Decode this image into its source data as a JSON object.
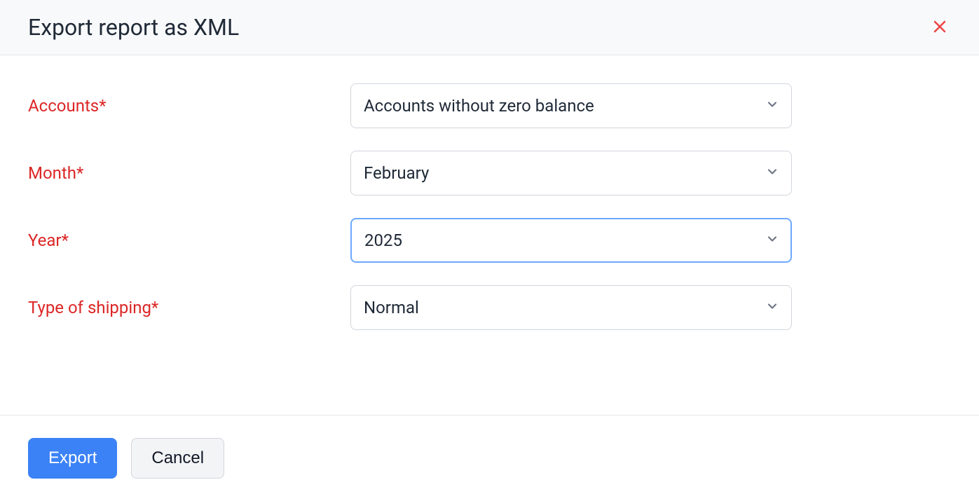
{
  "header": {
    "title": "Export report as XML"
  },
  "form": {
    "accounts": {
      "label": "Accounts*",
      "value": "Accounts without zero balance"
    },
    "month": {
      "label": "Month*",
      "value": "February"
    },
    "year": {
      "label": "Year*",
      "value": "2025"
    },
    "shipping": {
      "label": "Type of shipping*",
      "value": "Normal"
    }
  },
  "footer": {
    "export_label": "Export",
    "cancel_label": "Cancel"
  }
}
